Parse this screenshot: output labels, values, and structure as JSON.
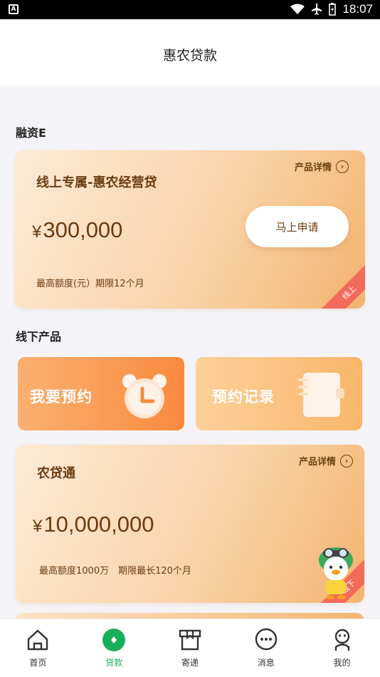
{
  "status_bar": {
    "time": "18:07",
    "left_badge": "A"
  },
  "navbar": {
    "title": "惠农贷款"
  },
  "sections": {
    "online": "融资E",
    "offline": "线下产品"
  },
  "online_card": {
    "details": "产品详情",
    "name": "线上专属-惠农经营贷",
    "currency": "¥",
    "amount": "300,000",
    "apply_label": "马上申请",
    "sub": "最高额度(元）期限12个月",
    "ribbon": "线上"
  },
  "tiles": {
    "reserve": "我要预约",
    "records": "预约记录"
  },
  "offline_card": {
    "details": "产品详情",
    "name": "农贷通",
    "currency": "¥",
    "amount": "10,000,000",
    "sub": "最高额度1000万　期限最长120个月",
    "ribbon": "线下"
  },
  "tabbar": {
    "items": [
      {
        "label": "首页",
        "icon": "home-icon"
      },
      {
        "label": "贷款",
        "icon": "loan-icon"
      },
      {
        "label": "寄递",
        "icon": "package-icon"
      },
      {
        "label": "消息",
        "icon": "message-icon"
      },
      {
        "label": "我的",
        "icon": "profile-icon"
      }
    ],
    "active_color": "#1aad5a"
  },
  "colors": {
    "brand_orange": "#f98a3e",
    "ribbon": "#f26a5a",
    "text_brown": "#6b3b10"
  }
}
